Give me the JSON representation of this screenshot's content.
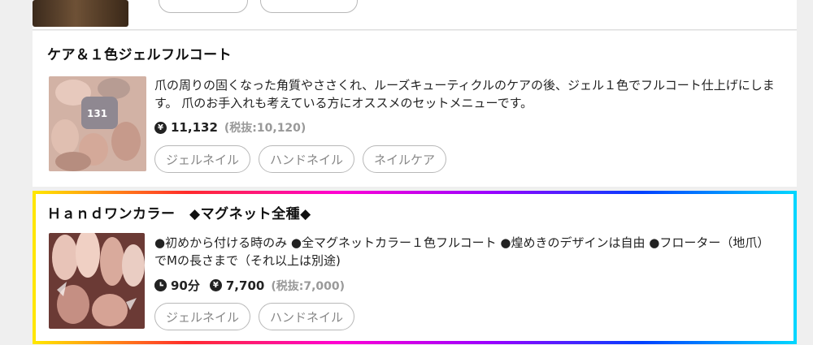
{
  "menu_items": [
    {
      "title": "ケア＆１色ジェルフルコート",
      "description": "爪の周りの固くなった角質やささくれ、ルーズキューティクルのケアの後、ジェル１色でフルコート仕上げにします。 爪のお手入れも考えている方にオススメのセットメニューです。",
      "price": "11,132",
      "tax_excluded": "(税抜:10,120)",
      "tags": [
        "ジェルネイル",
        "ハンドネイル",
        "ネイルケア"
      ]
    },
    {
      "title": "Ｈａｎｄワンカラー　◆マグネット全種◆",
      "description": "●初めから付ける時のみ ●全マグネットカラー１色フルコート ●煌めきのデザインは自由 ●フローター（地爪）でMの長さまで（それ以上は別途)",
      "duration": "90分",
      "price": "7,700",
      "tax_excluded": "(税抜:7,000)",
      "tags": [
        "ジェルネイル",
        "ハンドネイル"
      ]
    }
  ],
  "icons": {
    "yen": "¥",
    "clock": "clock-icon"
  },
  "colors": {
    "tag_text": "#888888",
    "tax_text": "#999999"
  }
}
